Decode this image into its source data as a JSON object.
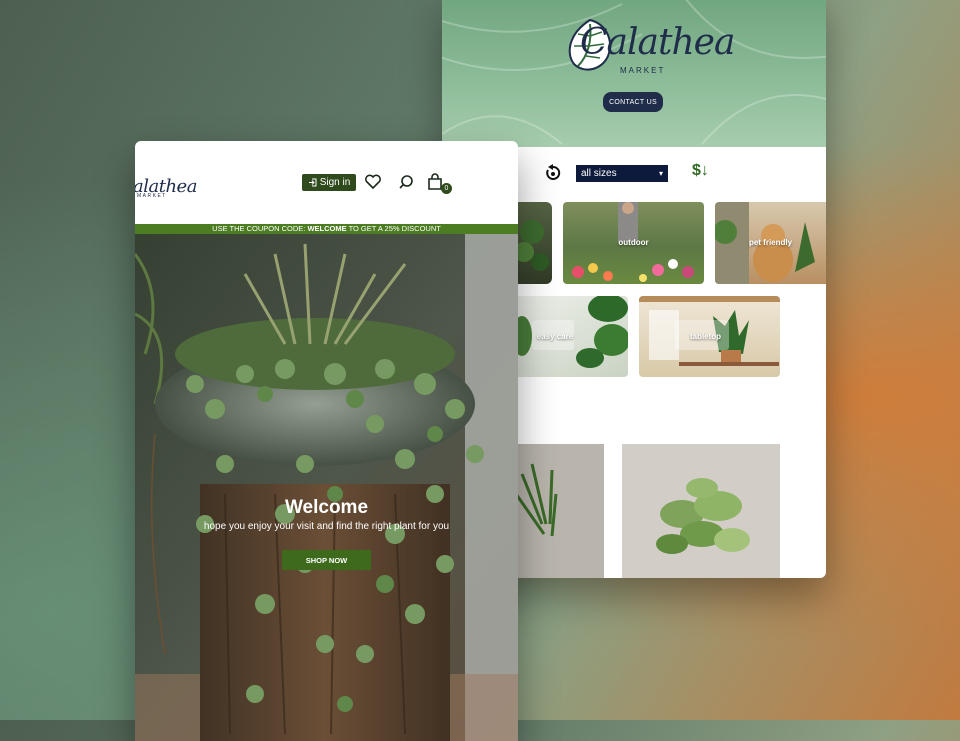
{
  "catalog": {
    "logo": {
      "name": "Calathea",
      "sub": "MARKET"
    },
    "contact_label": "CONTACT US",
    "size_filter": {
      "selected": "all sizes"
    },
    "sort_symbol": "$",
    "categories": [
      {
        "label": "outdoor"
      },
      {
        "label": "pet friendly"
      },
      {
        "label": "easy care"
      },
      {
        "label": "tabletop"
      }
    ]
  },
  "home": {
    "logo": {
      "name": "alathea",
      "sub": "MARKET"
    },
    "signin_label": "Sign in",
    "cart_count": "0",
    "coupon": {
      "prefix": "USE THE COUPON CODE: ",
      "code": "WELCOME",
      "suffix": " TO GET A 25% DISCOUNT"
    },
    "hero": {
      "title": "Welcome",
      "subtitle": "hope you enjoy your visit and find the right plant for you",
      "cta": "SHOP NOW"
    }
  },
  "colors": {
    "navy": "#1f2c4a",
    "brand_green": "#2f4a1c",
    "coupon_green": "#4d7d22"
  }
}
